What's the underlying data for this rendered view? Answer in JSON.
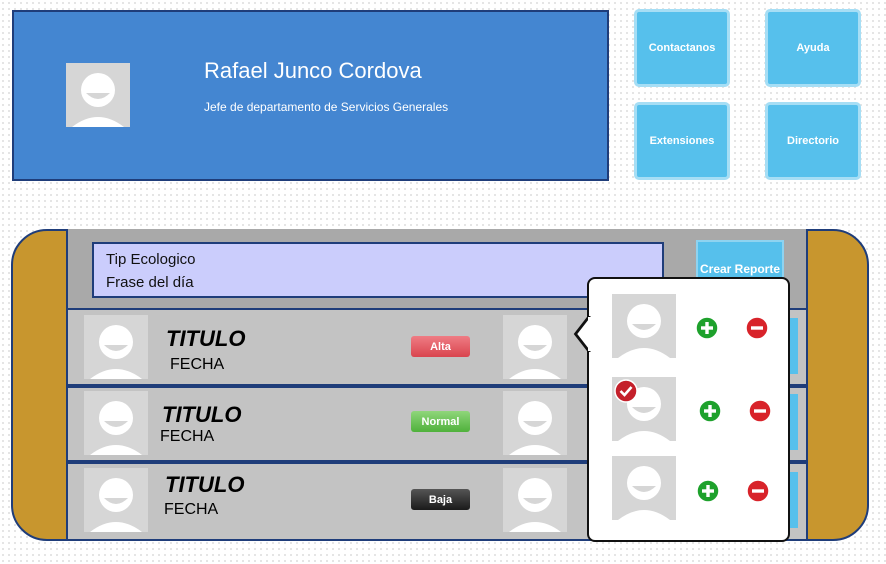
{
  "profile": {
    "name": "Rafael Junco Cordova",
    "role": "Jefe de departamento de Servicios Generales"
  },
  "nav": {
    "contact": "Contactanos",
    "help": "Ayuda",
    "extensions": "Extensiones",
    "directory": "Directorio"
  },
  "tip": {
    "line1": "Tip Ecologico",
    "line2": "Frase del día"
  },
  "create_report": "Crear Reporte",
  "reports": [
    {
      "title": "TITULO",
      "date": "FECHA",
      "priority": "Alta"
    },
    {
      "title": "TITULO",
      "date": "FECHA",
      "priority": "Normal"
    },
    {
      "title": "TITULO",
      "date": "FECHA",
      "priority": "Baja"
    }
  ],
  "colors": {
    "header_blue": "#4486d1",
    "button_blue": "#56c0ec",
    "board_gold": "#c8962e",
    "priority_high": "#d9444e",
    "priority_normal": "#4fb13b",
    "priority_low": "#222222",
    "add_green": "#1ea12c",
    "remove_red": "#d8232a"
  },
  "icons": {
    "avatar": "person-placeholder",
    "add": "plus-circle",
    "remove": "minus-circle",
    "selected": "check-circle"
  },
  "popover": {
    "selected_index": 1
  }
}
